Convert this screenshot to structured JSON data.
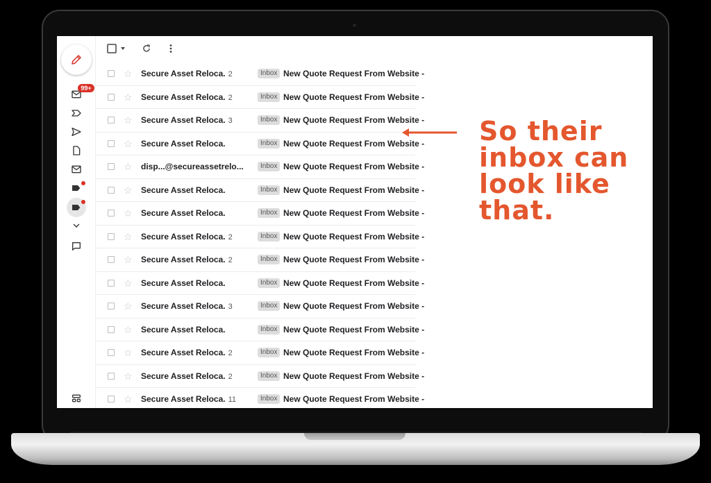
{
  "rail": {
    "badge": "99+"
  },
  "rows": [
    {
      "sender": "Secure Asset Reloca.",
      "count": "2",
      "label": "Inbox",
      "subject": "New Quote Request From Website -"
    },
    {
      "sender": "Secure Asset Reloca.",
      "count": "2",
      "label": "Inbox",
      "subject": "New Quote Request From Website -"
    },
    {
      "sender": "Secure Asset Reloca.",
      "count": "3",
      "label": "Inbox",
      "subject": "New Quote Request From Website -"
    },
    {
      "sender": "Secure Asset Reloca.",
      "count": "",
      "label": "Inbox",
      "subject": "New Quote Request From Website -"
    },
    {
      "sender": "disp...@secureassetrelo...",
      "count": "",
      "label": "Inbox",
      "subject": "New Quote Request From Website -"
    },
    {
      "sender": "Secure Asset Reloca.",
      "count": "",
      "label": "Inbox",
      "subject": "New Quote Request From Website -"
    },
    {
      "sender": "Secure Asset Reloca.",
      "count": "",
      "label": "Inbox",
      "subject": "New Quote Request From Website -"
    },
    {
      "sender": "Secure Asset Reloca.",
      "count": "2",
      "label": "Inbox",
      "subject": "New Quote Request From Website -"
    },
    {
      "sender": "Secure Asset Reloca.",
      "count": "2",
      "label": "Inbox",
      "subject": "New Quote Request From Website -"
    },
    {
      "sender": "Secure Asset Reloca.",
      "count": "",
      "label": "Inbox",
      "subject": "New Quote Request From Website -"
    },
    {
      "sender": "Secure Asset Reloca.",
      "count": "3",
      "label": "Inbox",
      "subject": "New Quote Request From Website -"
    },
    {
      "sender": "Secure Asset Reloca.",
      "count": "",
      "label": "Inbox",
      "subject": "New Quote Request From Website -"
    },
    {
      "sender": "Secure Asset Reloca.",
      "count": "2",
      "label": "Inbox",
      "subject": "New Quote Request From Website -"
    },
    {
      "sender": "Secure Asset Reloca.",
      "count": "2",
      "label": "Inbox",
      "subject": "New Quote Request From Website -"
    },
    {
      "sender": "Secure Asset Reloca.",
      "count": "11",
      "label": "Inbox",
      "subject": "New Quote Request From Website -"
    }
  ],
  "annotation": {
    "lines": [
      "So their",
      "inbox can",
      "look like",
      "that."
    ],
    "color": "#e4572e"
  },
  "icons": {
    "compose": "pencil-icon",
    "rail": [
      "mail-icon",
      "important-icon",
      "send-icon",
      "draft-icon",
      "all-mail-icon",
      "label-icon",
      "label-icon",
      "chevron-down-icon",
      "chat-icon",
      "apps-icon"
    ],
    "toolbar": [
      "checkbox-icon",
      "caret-down-icon",
      "refresh-icon",
      "more-vert-icon"
    ]
  }
}
